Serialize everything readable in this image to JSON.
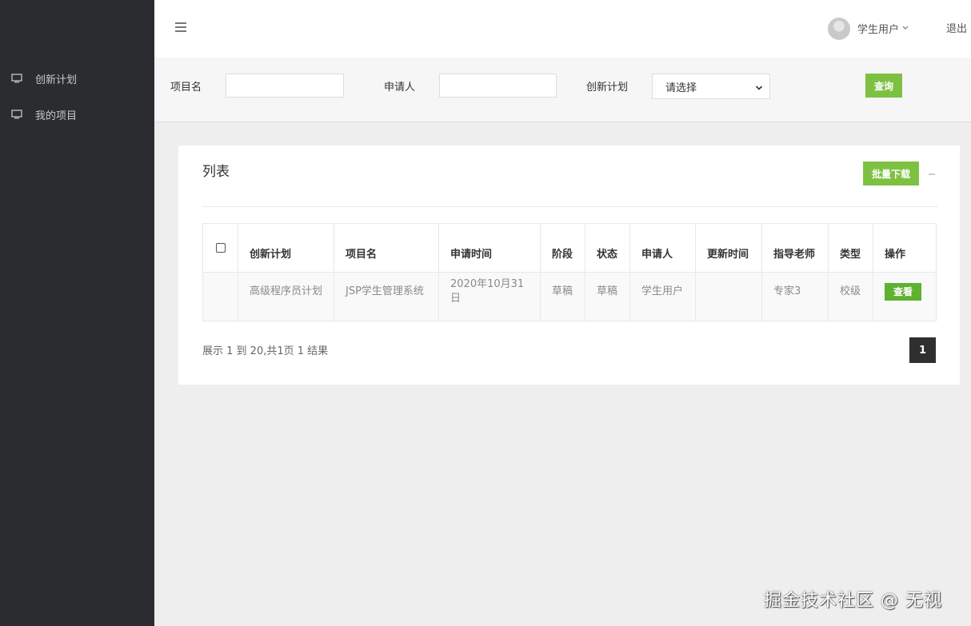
{
  "sidebar": {
    "items": [
      {
        "label": "创新计划",
        "icon": "monitor-icon"
      },
      {
        "label": "我的项目",
        "icon": "monitor-icon"
      }
    ]
  },
  "header": {
    "menu_icon": "hamburger-icon",
    "user_name": "学生用户",
    "logout_label": "退出"
  },
  "filters": {
    "project_name_label": "项目名",
    "project_name_value": "",
    "applicant_label": "申请人",
    "applicant_value": "",
    "plan_label": "创新计划",
    "plan_selected": "请选择",
    "search_label": "查询"
  },
  "panel": {
    "title": "列表",
    "batch_download_label": "批量下载",
    "collapse_symbol": "—"
  },
  "table": {
    "headers": [
      "创新计划",
      "项目名",
      "申请时间",
      "阶段",
      "状态",
      "申请人",
      "更新时间",
      "指导老师",
      "类型",
      "操作"
    ],
    "rows": [
      {
        "plan": "高级程序员计划",
        "project": "JSP学生管理系统",
        "apply_time": "2020年10月31日",
        "stage": "草稿",
        "status": "草稿",
        "applicant": "学生用户",
        "update_time": "",
        "advisor": "专家3",
        "type": "校级",
        "action": "查看"
      }
    ]
  },
  "pagination": {
    "info": "展示 1 到 20,共1页 1 结果",
    "current_page": "1"
  },
  "watermark": "掘金技术社区 @ 无视",
  "colors": {
    "sidebar_bg": "#2b2c2f",
    "accent_green": "#7ec142",
    "view_button_green": "#5fb130",
    "page_active": "#2f2f2f"
  }
}
